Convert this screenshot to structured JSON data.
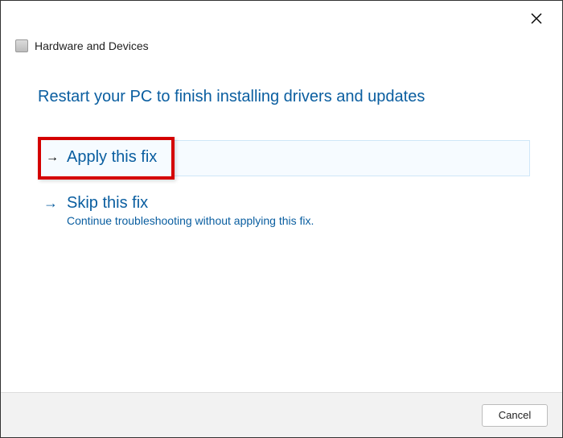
{
  "header": {
    "title": "Hardware and Devices"
  },
  "main": {
    "message": "Restart your PC to finish installing drivers and updates",
    "options": {
      "apply": {
        "title": "Apply this fix"
      },
      "skip": {
        "title": "Skip this fix",
        "desc": "Continue troubleshooting without applying this fix."
      }
    }
  },
  "footer": {
    "cancel": "Cancel"
  },
  "icons": {
    "arrow": "→",
    "close": "✕"
  },
  "colors": {
    "link": "#0a5ea0",
    "highlight_border": "#d40000",
    "footer_bg": "#f2f2f2"
  }
}
